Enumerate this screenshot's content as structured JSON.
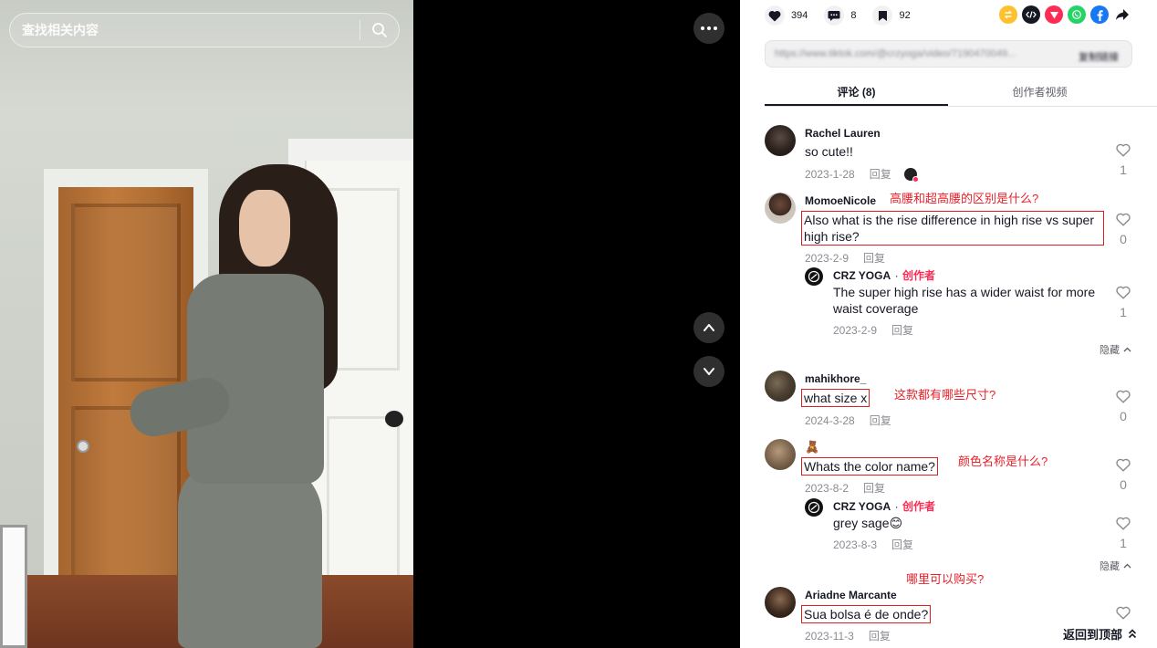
{
  "search": {
    "placeholder": "查找相关内容"
  },
  "actions": {
    "likes": "394",
    "comments": "8",
    "saves": "92"
  },
  "share_icons": [
    "repost-icon",
    "embed-icon",
    "send-icon",
    "whatsapp-icon",
    "facebook-icon",
    "share-arrow-icon"
  ],
  "url_bar": {
    "url": "https://www.tiktok.com/@crzyoga/video/7190470049...",
    "copy_label": "复制链接"
  },
  "tabs": {
    "comments": "评论 (8)",
    "creator_videos": "创作者视频"
  },
  "comments": [
    {
      "name": "Rachel Lauren",
      "text": "so cute!!",
      "date": "2023-1-28",
      "reply": "回复",
      "likes": "1"
    },
    {
      "name": "MomoeNicole",
      "text": "Also what is the rise difference in high rise vs super high rise?",
      "date": "2023-2-9",
      "reply": "回复",
      "likes": "0",
      "annotation": "高腰和超高腰的区别是什么?",
      "reply_item": {
        "name": "CRZ YOGA",
        "creator": "创作者",
        "text": "The super high rise has a wider waist for more waist coverage",
        "date": "2023-2-9",
        "reply": "回复",
        "likes": "1"
      },
      "hide": "隐藏"
    },
    {
      "name": "mahikhore_",
      "text": "what size x",
      "date": "2024-3-28",
      "reply": "回复",
      "likes": "0",
      "annotation": "这款都有哪些尺寸?"
    },
    {
      "name": "🧸",
      "text": "Whats the color name?",
      "date": "2023-8-2",
      "reply": "回复",
      "likes": "0",
      "annotation": "颜色名称是什么?",
      "reply_item": {
        "name": "CRZ YOGA",
        "creator": "创作者",
        "text": "grey sage😊",
        "date": "2023-8-3",
        "reply": "回复",
        "likes": "1"
      },
      "hide": "隐藏"
    },
    {
      "name": "Ariadne Marcante",
      "text": "Sua bolsa é de onde?",
      "date": "2023-11-3",
      "reply": "回复",
      "annotation": "哪里可以购买?"
    }
  ],
  "back_to_top": "返回到顶部",
  "colors": {
    "accent": "#fe2c55",
    "annotation": "#e8202a",
    "text": "#161823",
    "muted": "#8a8b91"
  }
}
